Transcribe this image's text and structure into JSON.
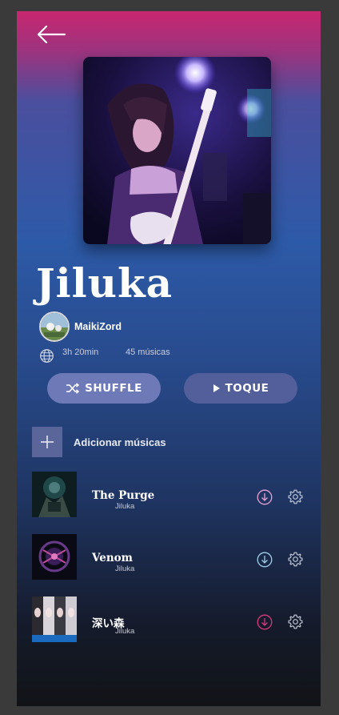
{
  "playlist": {
    "title": "Jiluka",
    "owner": "MaikiZord",
    "duration": "3h 20min",
    "track_count": "45 músicas"
  },
  "actions": {
    "shuffle_label": "SHUFFLE",
    "play_label": "TOQUE",
    "add_label": "Adicionar músicas"
  },
  "tracks": [
    {
      "title": "The Purge",
      "artist": "Jiluka",
      "download_color": "#e9a2d0"
    },
    {
      "title": "Venom",
      "artist": "Jiluka",
      "download_color": "#9fd0ea"
    },
    {
      "title": "深い森",
      "artist": "Jiluka",
      "download_color": "#d83a7c"
    }
  ],
  "icons": {
    "back": "arrow-left-icon",
    "globe": "globe-icon",
    "shuffle": "shuffle-icon",
    "play": "play-icon",
    "add": "plus-icon",
    "download": "download-circle-icon",
    "settings": "gear-icon"
  }
}
